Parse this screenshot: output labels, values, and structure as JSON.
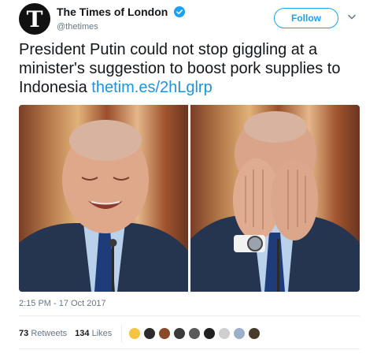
{
  "header": {
    "avatar_letter": "T",
    "display_name": "The Times of London",
    "handle": "@thetimes",
    "follow_label": "Follow",
    "verified_icon": "verified-badge-icon",
    "menu_icon": "chevron-down-icon"
  },
  "tweet": {
    "text": "President Putin could not stop giggling at a minister's suggestion to boost pork supplies to Indonesia ",
    "link": "thetim.es/2hLglrp"
  },
  "media": {
    "photos": [
      "photo-laughing",
      "photo-hands-over-face"
    ]
  },
  "meta": {
    "timestamp": "2:15 PM - 17 Oct 2017"
  },
  "stats": {
    "retweets_count": "73",
    "retweets_label": "Retweets",
    "likes_count": "134",
    "likes_label": "Likes"
  },
  "colors": {
    "accent": "#1da1f2",
    "link": "#1b95e0",
    "muted": "#657786",
    "divider": "#e6ecf0"
  },
  "liker_avatar_colors": [
    "#f5c542",
    "#2b2b2b",
    "#8a4a2a",
    "#3a3a3a",
    "#5a5a5a",
    "#222222",
    "#cfcfcf",
    "#9ab0c8",
    "#4a3a2a"
  ]
}
